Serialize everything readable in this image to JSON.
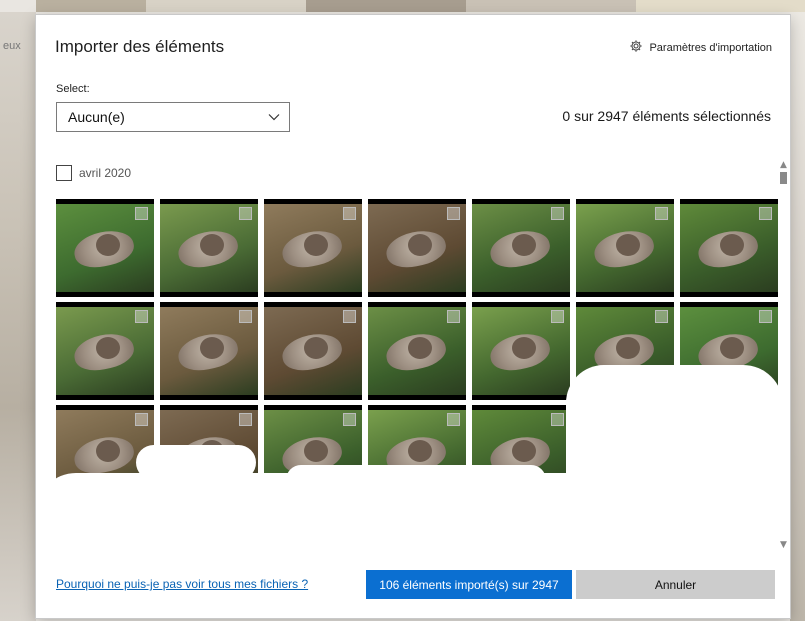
{
  "background": {
    "left_caption": "eux"
  },
  "dialog": {
    "title": "Importer des éléments",
    "settings_link": "Paramètres d'importation",
    "select_label": "Select:",
    "select_value": "Aucun(e)",
    "selection_count": "0 sur 2947 éléments sélectionnés",
    "group_label": "avril 2020",
    "help_link": "Pourquoi ne puis-je pas voir tous mes fichiers ?",
    "import_button": "106 éléments importé(s) sur 2947",
    "cancel_button": "Annuler"
  },
  "icons": {
    "settings": "gear-icon",
    "select": "chevron-down-icon",
    "scroll_up": "scroll-up-arrow-icon",
    "scroll_down": "scroll-down-arrow-icon"
  },
  "colors": {
    "primary_button": "#0b6fd1",
    "secondary_button": "#cccccc",
    "link": "#0a63b4"
  },
  "thumbnail_count": 21
}
